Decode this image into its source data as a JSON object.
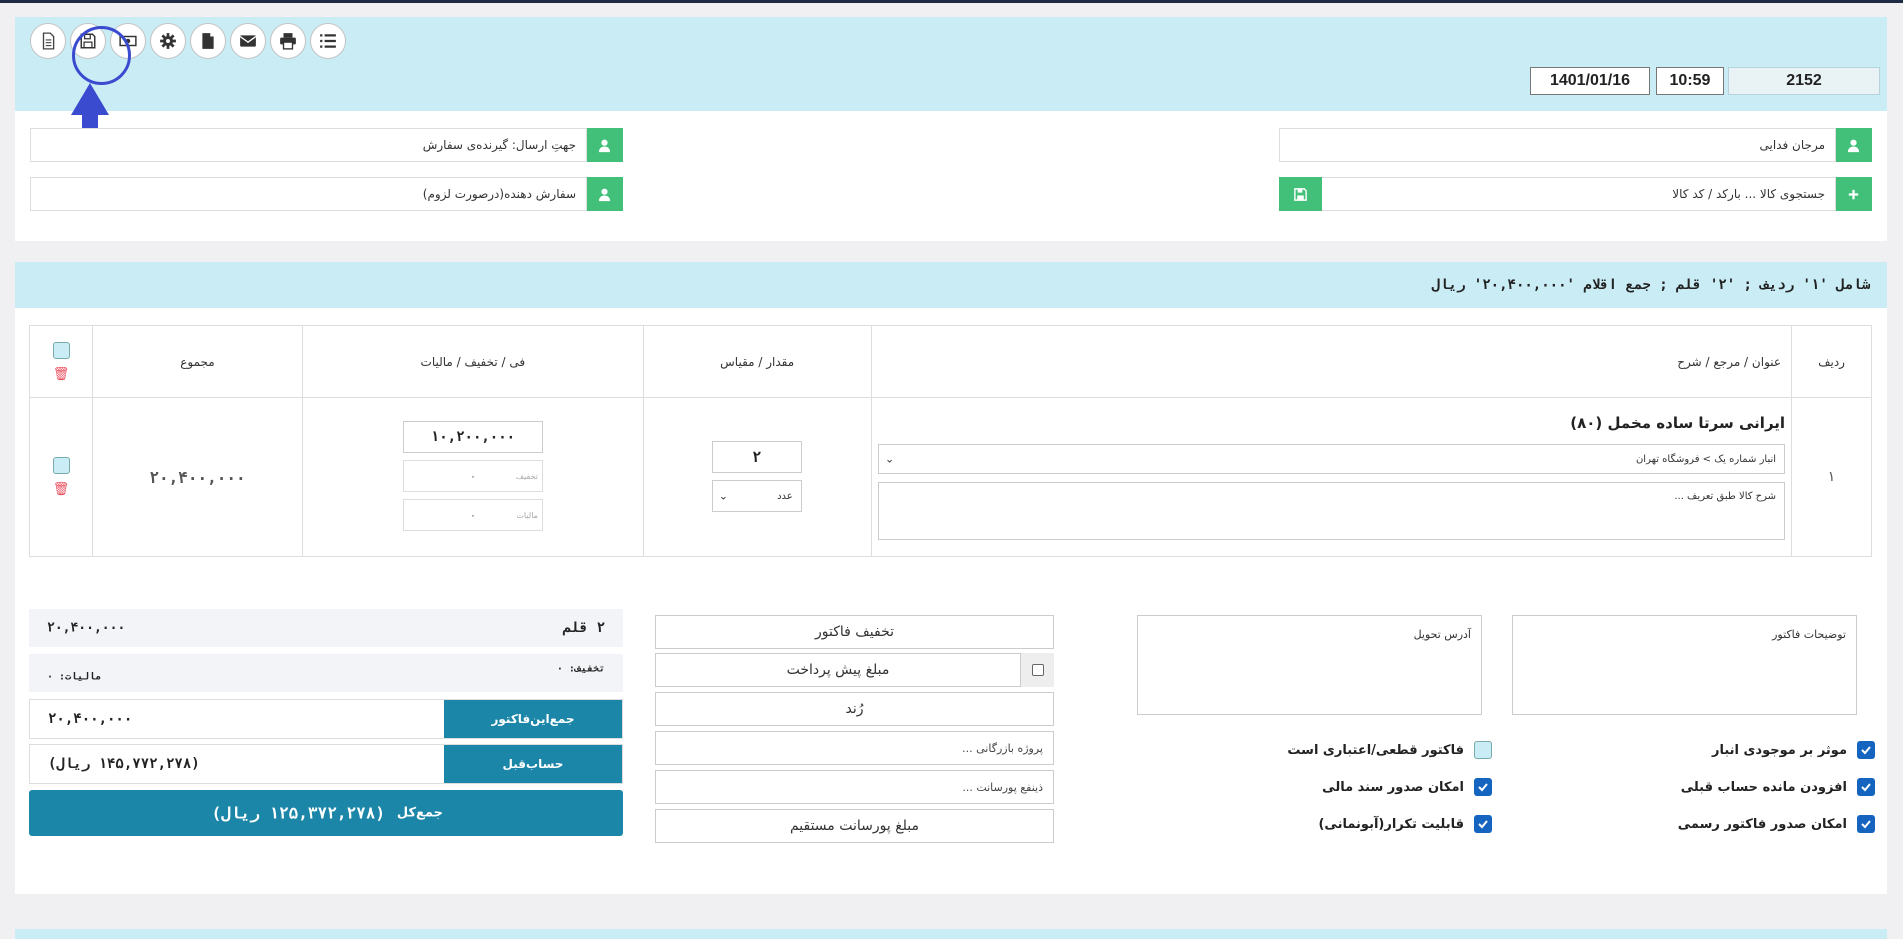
{
  "header": {
    "date": "1401/01/16",
    "time": "10:59",
    "doc_number": "2152"
  },
  "toolbar": {
    "buttons": [
      "new-doc-icon",
      "save-icon",
      "cash-icon",
      "gear-icon",
      "file-icon",
      "envelope-icon",
      "printer-icon",
      "list-icon"
    ]
  },
  "customer": {
    "name": "مرجان فدایی",
    "product_search_placeholder": "جستجوی کالا ... بارکد / کد کالا",
    "ship_to": "جهتِ ارسال: گیرنده‌ی سفارش",
    "orderer": "سفارش دهنده(درصورت لزوم)"
  },
  "summary": "شامل '۱' ردیف ; '۲' قلم ; جمع اقلام '۲۰,۴۰۰,۰۰۰' ریال",
  "table": {
    "headers": {
      "row": "ردیف",
      "title": "عنوان / مرجع / شرح",
      "qty": "مقدار / مقیاس",
      "price": "فی / تخفیف / مالیات",
      "total": "مجموع"
    },
    "rows": [
      {
        "num": "۱",
        "title": "ایرانی سرتا ساده مخمل (۸۰)",
        "warehouse": "انبار شماره یک > فروشگاه تهران",
        "desc_placeholder": "شرح کالا طبق تعریف ...",
        "qty": "۲",
        "unit": "عدد",
        "price": "۱۰,۲۰۰,۰۰۰",
        "discount": "۰",
        "discount_label": "تخفیف",
        "tax": "۰",
        "tax_label": "مالیات",
        "total": "۲۰,۴۰۰,۰۰۰"
      }
    ]
  },
  "totals": {
    "items_count": "۲ قلم",
    "items_sum": "۲۰,۴۰۰,۰۰۰",
    "discount": "تخفیف: ۰",
    "tax": "مالیات: ۰",
    "invoice_sum_label": "جمع‌این‌فاکتور",
    "invoice_sum": "۲۰,۴۰۰,۰۰۰",
    "prev_balance_label": "حساب‌قبل",
    "prev_balance": "(۱۴۵,۷۷۲,۲۷۸ ریال)",
    "grand_label": "جمع‌کل",
    "grand": "(۱۲۵,۳۷۲,۲۷۸ ریال)"
  },
  "actions": {
    "invoice_discount": "تخفیف فاکتور",
    "prepayment": "مبلغ پیش پرداخت",
    "round": "رُند",
    "marketing_project": "پروژه بازرگانی ...",
    "commission_beneficiary": "ذینفع پورسانت ...",
    "direct_commission": "مبلغ پورسانت مستقیم"
  },
  "notes": {
    "delivery_address": "آدرس تحویل",
    "invoice_notes": "توضیحات فاکتور"
  },
  "options": {
    "affect_stock": "موثر بر موجودی انبار",
    "add_prev_balance": "افزودن مانده حساب قبلی",
    "official_invoice": "امکان صدور فاکتور رسمی",
    "final_invoice": "فاکتور قطعی/اعتباری است",
    "financial_doc": "امکان صدور سند مالی",
    "recurring": "قابلیت تکرار(آبونمانی)"
  },
  "colors": {
    "accent": "#1b86a8",
    "band": "#c9ecf5",
    "green": "#42c07a",
    "highlight": "#3a4bd0"
  }
}
